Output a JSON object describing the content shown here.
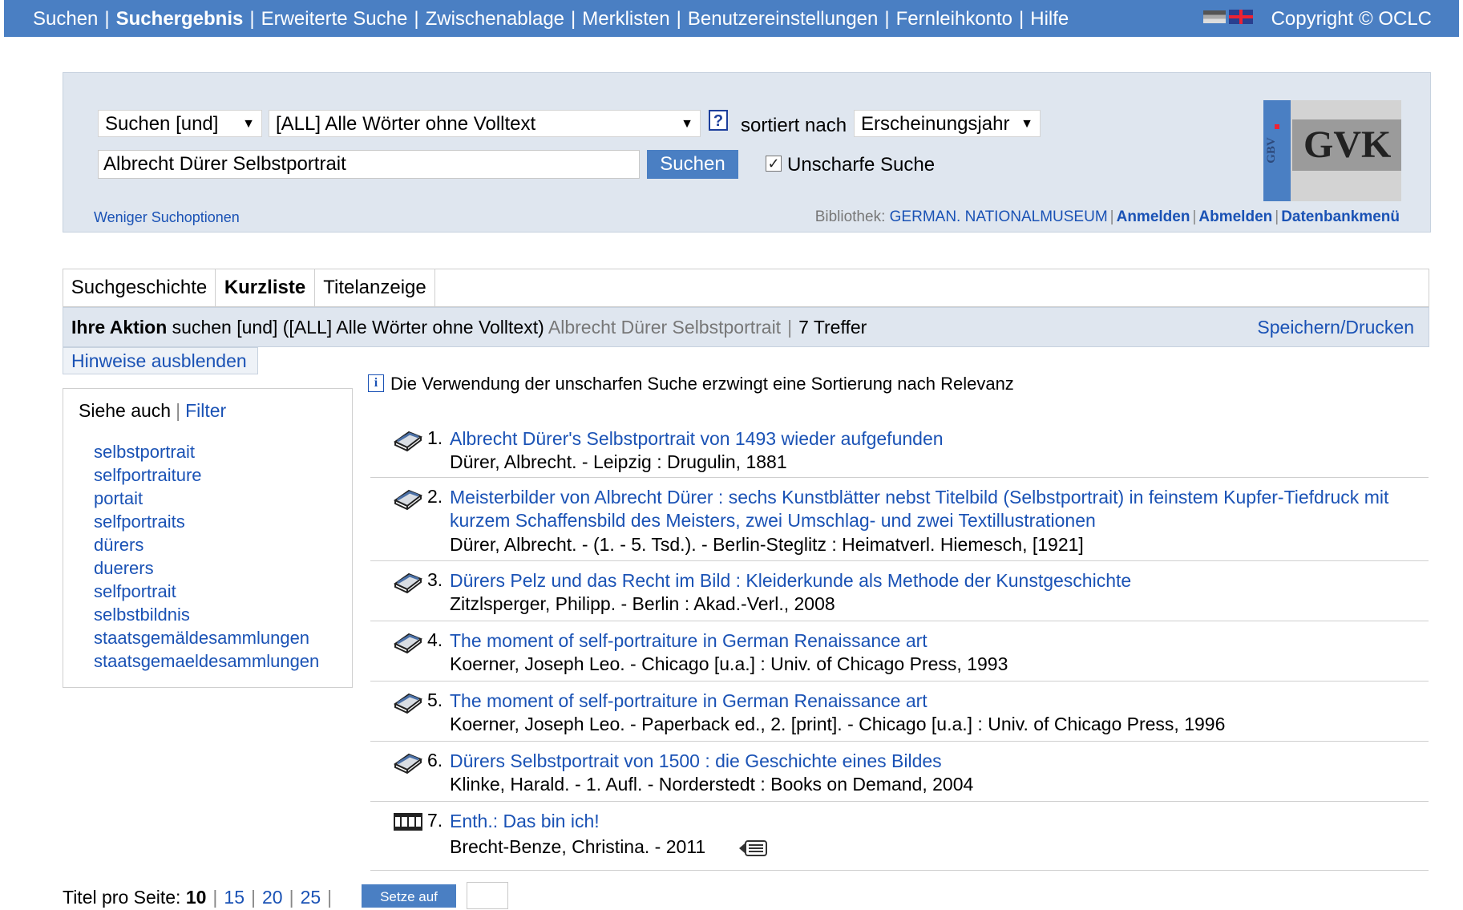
{
  "nav": {
    "items": [
      "Suchen",
      "Suchergebnis",
      "Erweiterte Suche",
      "Zwischenablage",
      "Merklisten",
      "Benutzereinstellungen",
      "Fernleihkonto",
      "Hilfe"
    ],
    "active": "Suchergebnis",
    "copyright": "Copyright © OCLC"
  },
  "search": {
    "operator": "Suchen [und]",
    "field": "[ALL] Alle Wörter ohne Volltext",
    "help": "?",
    "sort_label": "sortiert nach",
    "sort_value": "Erscheinungsjahr",
    "query": "Albrecht Dürer Selbstportrait",
    "button": "Suchen",
    "fuzzy_label": "Unscharfe Suche",
    "fuzzy_checked": true,
    "less_options": "Weniger Suchoptionen",
    "library_label": "Bibliothek:",
    "library_name": "GERMAN. NATIONALMUSEUM",
    "login": "Anmelden",
    "logout": "Abmelden",
    "dbmenu": "Datenbankmenü"
  },
  "logo": {
    "small": "GBV",
    "big": "GVK"
  },
  "tabs": [
    "Suchgeschichte",
    "Kurzliste",
    "Titelanzeige"
  ],
  "action": {
    "label": "Ihre Aktion",
    "text": "suchen [und] ([ALL] Alle Wörter ohne Volltext)",
    "query": "Albrecht Dürer Selbstportrait",
    "hits": "7 Treffer",
    "save": "Speichern/Drucken"
  },
  "hints_toggle": "Hinweise ausblenden",
  "sidebar": {
    "see_also": "Siehe auch",
    "filter": "Filter",
    "terms": [
      "selbstportrait",
      "selfportraiture",
      "portait",
      "selfportraits",
      "dürers",
      "duerers",
      "selfportrait",
      "selbstbildnis",
      "staatsgemäldesammlungen",
      "staatsgemaeldesammlungen"
    ]
  },
  "info": {
    "icon": "i",
    "text": "Die Verwendung der unscharfen Suche erzwingt eine Sortierung nach Relevanz"
  },
  "results": [
    {
      "num": "1.",
      "type": "book-icon",
      "title": "Albrecht Dürer's Selbstportrait von 1493 wieder aufgefunden",
      "meta": "Dürer, Albrecht. - Leipzig : Drugulin, 1881"
    },
    {
      "num": "2.",
      "type": "book-icon",
      "title": "Meisterbilder von Albrecht Dürer : sechs Kunstblätter nebst Titelbild (Selbstportrait) in feinstem Kupfer-Tiefdruck mit kurzem Schaffensbild des Meisters, zwei Umschlag- und zwei Textillustrationen",
      "meta": "Dürer, Albrecht. - (1. - 5. Tsd.). - Berlin-Steglitz : Heimatverl. Hiemesch, [1921]"
    },
    {
      "num": "3.",
      "type": "book-icon",
      "title": "Dürers Pelz und das Recht im Bild : Kleiderkunde als Methode der Kunstgeschichte",
      "meta": "Zitzlsperger, Philipp. - Berlin : Akad.-Verl., 2008"
    },
    {
      "num": "4.",
      "type": "book-icon",
      "title": "The moment of self-portraiture in German Renaissance art",
      "meta": "Koerner, Joseph Leo. - Chicago [u.a.] : Univ. of Chicago Press, 1993"
    },
    {
      "num": "5.",
      "type": "book-icon",
      "title": "The moment of self-portraiture in German Renaissance art",
      "meta": "Koerner, Joseph Leo. - Paperback ed., 2. [print]. - Chicago [u.a.] : Univ. of Chicago Press, 1996"
    },
    {
      "num": "6.",
      "type": "book-icon",
      "title": "Dürers Selbstportrait von 1500 : die Geschichte eines Bildes",
      "meta": "Klinke, Harald. - 1. Aufl. - Norderstedt : Books on Demand, 2004"
    },
    {
      "num": "7.",
      "type": "film-icon",
      "title": "Enth.: Das bin ich!",
      "meta": "Brecht-Benze, Christina. - 2011"
    }
  ],
  "pager": {
    "label": "Titel pro Seite:",
    "current": "10",
    "options": [
      "15",
      "20",
      "25"
    ],
    "button": "Setze auf"
  }
}
